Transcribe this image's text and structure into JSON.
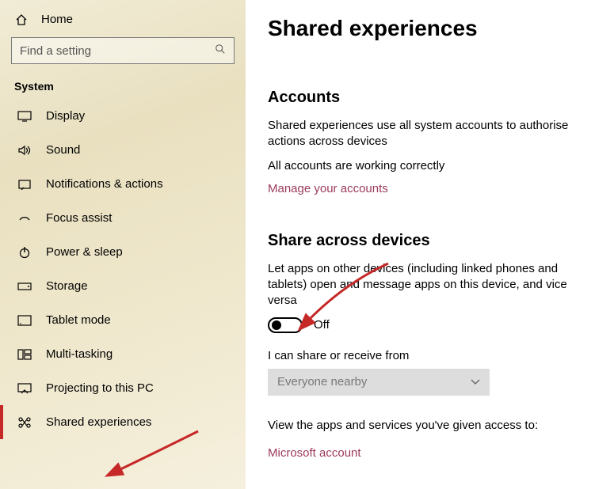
{
  "sidebar": {
    "home": "Home",
    "search_placeholder": "Find a setting",
    "section": "System",
    "items": [
      {
        "label": "Display"
      },
      {
        "label": "Sound"
      },
      {
        "label": "Notifications & actions"
      },
      {
        "label": "Focus assist"
      },
      {
        "label": "Power & sleep"
      },
      {
        "label": "Storage"
      },
      {
        "label": "Tablet mode"
      },
      {
        "label": "Multi-tasking"
      },
      {
        "label": "Projecting to this PC"
      },
      {
        "label": "Shared experiences"
      }
    ]
  },
  "page": {
    "title": "Shared experiences",
    "accounts": {
      "heading": "Accounts",
      "desc": "Shared experiences use all system accounts to authorise actions across devices",
      "status": "All accounts are working correctly",
      "link": "Manage your accounts"
    },
    "share": {
      "heading": "Share across devices",
      "desc": "Let apps on other devices (including linked phones and tablets) open and message apps on this device, and vice versa",
      "toggle_state": "Off",
      "receive_label": "I can share or receive from",
      "receive_value": "Everyone nearby",
      "view_apps": "View the apps and services you've given access to:",
      "ms_link": "Microsoft account"
    }
  }
}
